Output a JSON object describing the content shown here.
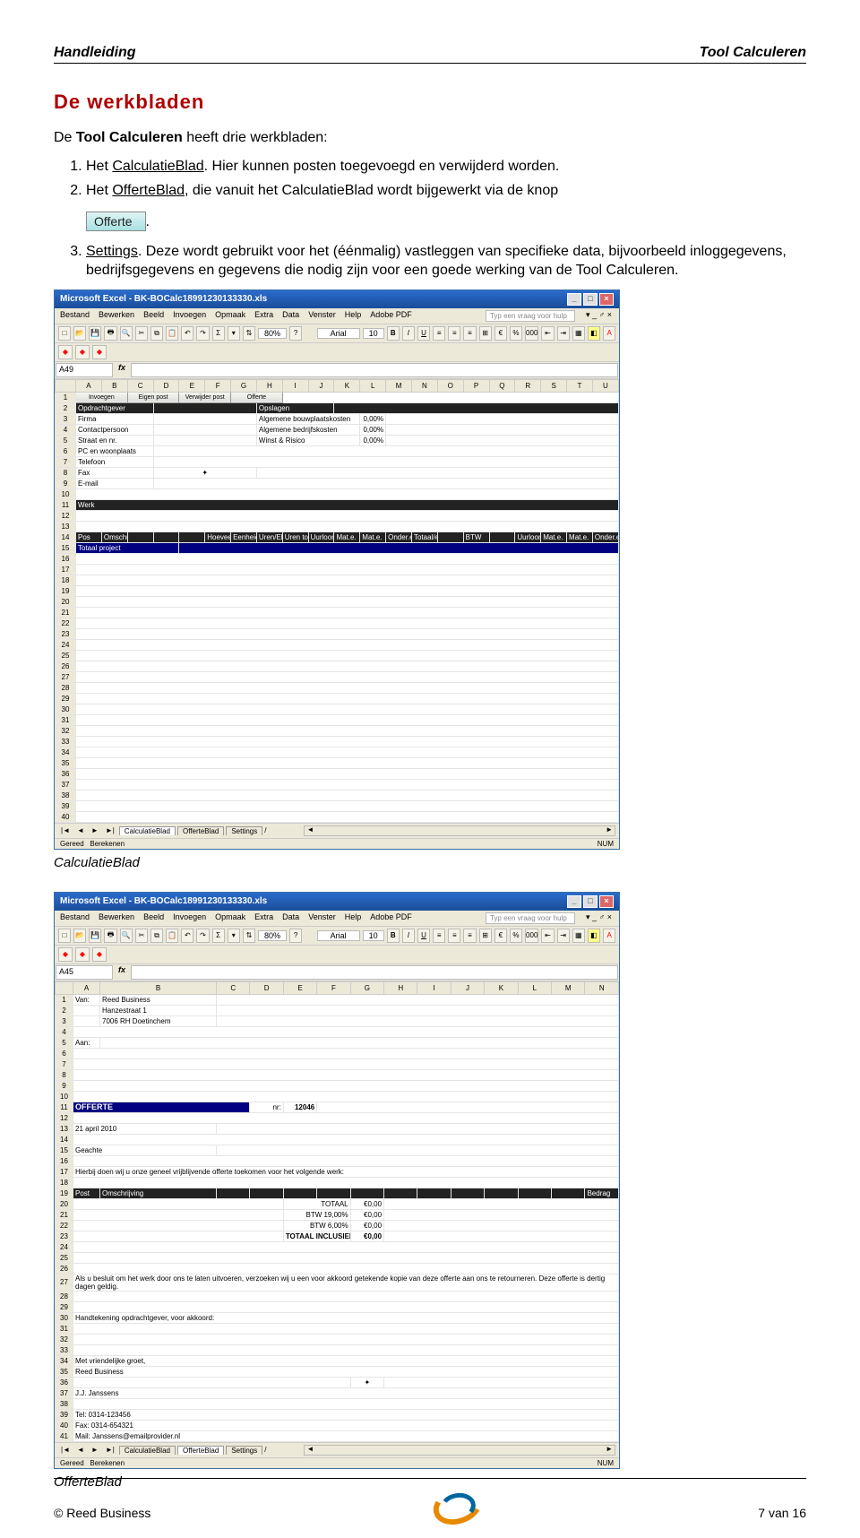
{
  "header": {
    "left": "Handleiding",
    "right": "Tool Calculeren"
  },
  "section_title": "De werkbladen",
  "intro_pre": "De ",
  "intro_bold": "Tool Calculeren",
  "intro_post": " heeft drie werkbladen:",
  "li1_pre": "Het ",
  "li1_u": "CalculatieBlad",
  "li1_post": ". Hier kunnen posten toegevoegd en verwijderd worden.",
  "li2_pre": "Het ",
  "li2_u": "OfferteBlad",
  "li2_post": ", die vanuit het CalculatieBlad wordt bijgewerkt via de knop",
  "offerte_btn": "Offerte",
  "li2_tail": ".",
  "li3_u": "Settings",
  "li3_post": ". Deze wordt gebruikt voor het (éénmalig) vastleggen van specifieke data, bijvoorbeeld inloggegevens, bedrijfsgegevens en gegevens die nodig zijn voor een goede werking van de Tool Calculeren.",
  "excel": {
    "title": "Microsoft Excel - BK-BOCalc18991230133330.xls",
    "menu": [
      "Bestand",
      "Bewerken",
      "Beeld",
      "Invoegen",
      "Opmaak",
      "Extra",
      "Data",
      "Venster",
      "Help",
      "Adobe PDF"
    ],
    "help_placeholder": "Typ een vraag voor hulp",
    "zoom": "80%",
    "font": "Arial",
    "fontsize": "10",
    "status_left": "Gereed",
    "status_mid": "Berekenen",
    "status_right": "NUM",
    "tabs": [
      "CalculatieBlad",
      "OfferteBlad",
      "Settings"
    ]
  },
  "shot1": {
    "namebox": "A49",
    "cols": [
      "",
      "A",
      "B",
      "C",
      "D",
      "E",
      "F",
      "G",
      "H",
      "I",
      "J",
      "K",
      "L",
      "M",
      "N",
      "O",
      "P",
      "Q",
      "R",
      "S",
      "T",
      "U"
    ],
    "buttons": [
      "Invoegen",
      "Eigen post",
      "Verwijder post",
      "Offerte"
    ],
    "row2_label": "Opdrachtgever",
    "row2_labelR": "Opslagen",
    "rows_left": [
      "Firma",
      "Contactpersoon",
      "Straat en nr.",
      "PC en woonplaats",
      "Telefoon",
      "Fax",
      "E-mail"
    ],
    "rows_right": [
      "Algemene bouwplaatskosten",
      "Algemene bedrijfskosten",
      "Winst & Risico"
    ],
    "vals_right": [
      "0,00%",
      "0,00%",
      "0,00%"
    ],
    "werk": "Werk",
    "hdr": [
      "Pos",
      "Omschrijving",
      "",
      "",
      "",
      "Hoeveelheid",
      "Eenheid",
      "Uren/Eh",
      "Uren tot",
      "Uurloon",
      "Mat.e.",
      "Mat.e.",
      "Onder.e.",
      "Totaal/e",
      "",
      "BTW",
      "",
      "Uurloon",
      "Mat.e.",
      "Mat.e.",
      "Onder.e."
    ],
    "totaal": "Totaal project"
  },
  "caption1": "CalculatieBlad",
  "shot2": {
    "namebox": "A45",
    "cols": [
      "",
      "A",
      "B",
      "C",
      "D",
      "E",
      "F",
      "G",
      "H",
      "I",
      "J",
      "K",
      "L",
      "M",
      "N"
    ],
    "van": "Van:",
    "van_lines": [
      "Reed Business",
      "Hanzestraat 1",
      "7006 RH Doetinchem"
    ],
    "aan": "Aan:",
    "offerte": "OFFERTE",
    "nr_label": "nr:",
    "nr_val": "12046",
    "date": "21 april 2010",
    "geachte": "Geachte",
    "intro_line": "Hierbij doen wij u onze geneel vrijblijvende offerte toekomen voor het volgende werk:",
    "table_hdr": [
      "Post",
      "Omschrijving",
      "",
      "",
      "",
      "",
      "",
      "",
      "",
      "",
      "",
      "",
      "",
      "Bedrag"
    ],
    "totals": [
      [
        "TOTAAL",
        "€0,00"
      ],
      [
        "BTW 19,00%",
        "€0,00"
      ],
      [
        "BTW  6,00%",
        "€0,00"
      ],
      [
        "TOTAAL INCLUSIEF BTW",
        "€0,00"
      ]
    ],
    "clause": "Als u besluit om het werk door ons te laten uitvoeren, verzoeken wij u een voor akkoord getekende kopie van deze offerte aan ons te retourneren. Deze offerte is dertig dagen geldig.",
    "signline": "Handtekening opdrachtgever, voor akkoord:",
    "greet": "Met vriendelijke groet,",
    "comp": "Reed Business",
    "person": "J.J. Janssens",
    "tel": "Tel: 0314-123456",
    "fax": "Fax: 0314-654321",
    "mail": "Mail: Janssens@emailprovider.nl"
  },
  "caption2": "OfferteBlad",
  "footer": {
    "left": "© Reed Business",
    "right": "7 van 16"
  }
}
